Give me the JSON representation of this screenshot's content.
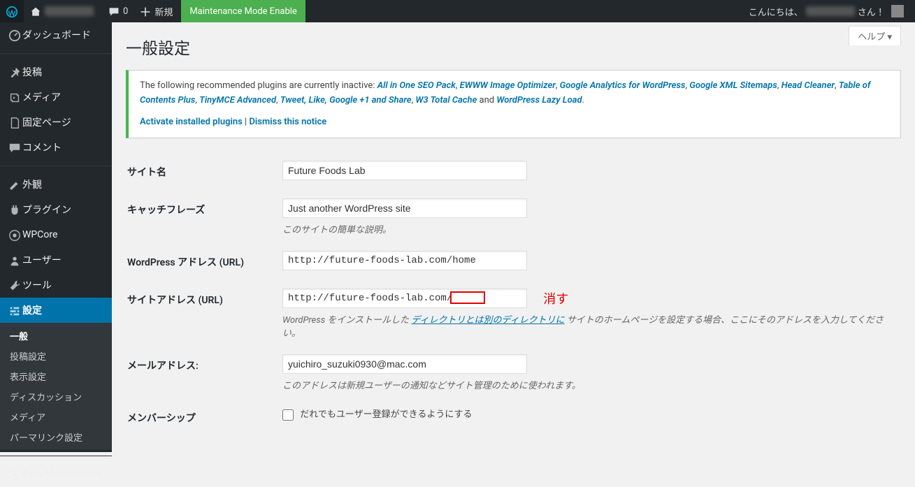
{
  "adminbar": {
    "comments_count": "0",
    "new_label": "新規",
    "maintenance_label": "Maintenance Mode Enable",
    "greeting_prefix": "こんにちは、",
    "greeting_suffix": " さん ！"
  },
  "help": {
    "label": "ヘルプ"
  },
  "menu": {
    "dashboard": "ダッシュボード",
    "posts": "投稿",
    "media": "メディア",
    "pages": "固定ページ",
    "comments": "コメント",
    "appearance": "外観",
    "plugins": "プラグイン",
    "wpcore": "WPCore",
    "users": "ユーザー",
    "tools": "ツール",
    "settings": "設定",
    "easy_maintenance": "Easy Maintenance"
  },
  "submenu": {
    "general": "一般",
    "writing": "投稿設定",
    "reading": "表示設定",
    "discussion": "ディスカッション",
    "media": "メディア",
    "permalinks": "パーマリンク設定"
  },
  "page": {
    "title": "一般設定"
  },
  "notice": {
    "intro": "The following recommended plugins are currently inactive: ",
    "plugins": [
      "All in One SEO Pack",
      "EWWW Image Optimizer",
      "Google Analytics for WordPress",
      "Google XML Sitemaps",
      "Head Cleaner",
      "Table of Contents Plus",
      "TinyMCE Advanced",
      "Tweet, Like, Google +1 and Share",
      "W3 Total Cache"
    ],
    "and": " and ",
    "last_plugin": "WordPress Lazy Load",
    "period": ".",
    "activate": "Activate installed plugins",
    "sep": " | ",
    "dismiss": "Dismiss this notice"
  },
  "form": {
    "site_name_label": "サイト名",
    "site_name_value": "Future Foods Lab",
    "tagline_label": "キャッチフレーズ",
    "tagline_value": "Just another WordPress site",
    "tagline_desc": "このサイトの簡単な説明。",
    "wp_url_label": "WordPress アドレス (URL)",
    "wp_url_value": "http://future-foods-lab.com/home",
    "site_url_label": "サイトアドレス (URL)",
    "site_url_value": "http://future-foods-lab.com/",
    "site_url_desc_pre": "WordPress をインストールした",
    "site_url_desc_link": "ディレクトリとは別のディレクトリに",
    "site_url_desc_post": "サイトのホームページを設定する場合、ここにそのアドレスを入力してください。",
    "email_label": "メールアドレス:",
    "email_value": "yuichiro_suzuki0930@mac.com",
    "email_desc": "このアドレスは新規ユーザーの通知などサイト管理のために使われます。",
    "membership_label": "メンバーシップ",
    "membership_check_label": "だれでもユーザー登録ができるようにする"
  },
  "annotation": {
    "kesu": "消す"
  }
}
